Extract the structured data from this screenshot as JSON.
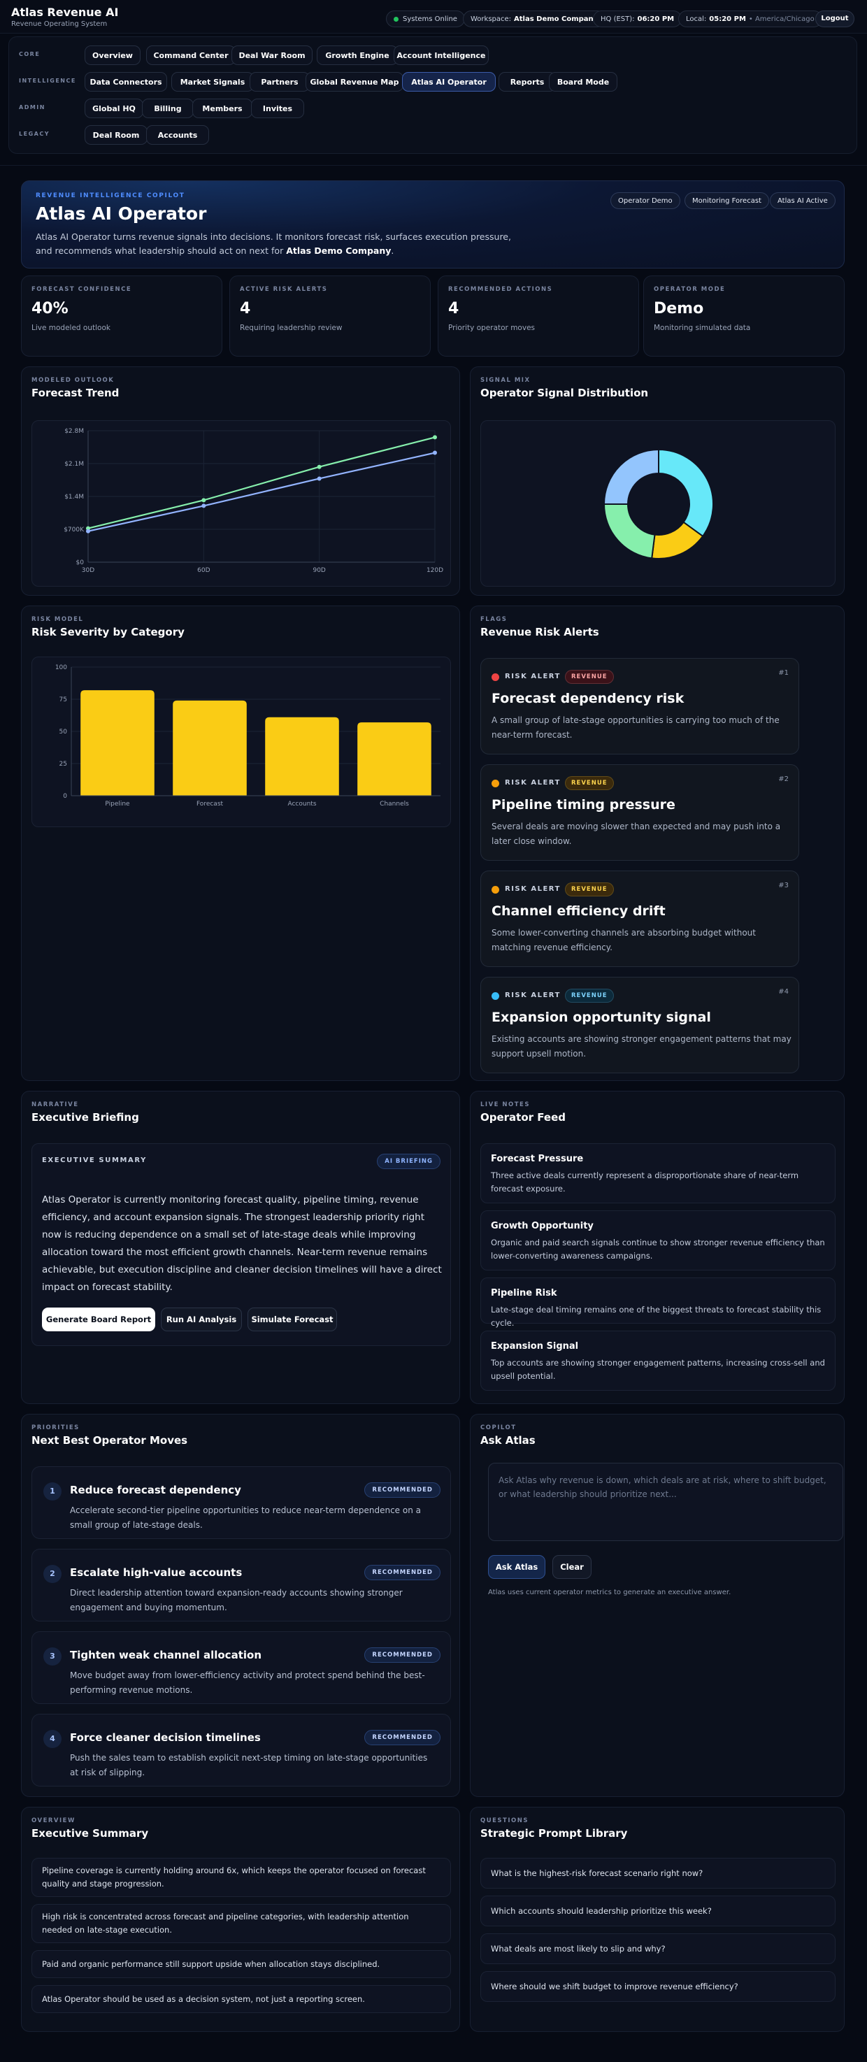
{
  "header": {
    "title": "Atlas Revenue AI",
    "subtitle": "Revenue Operating System",
    "status": "Systems Online",
    "workspace_label": "Workspace:",
    "workspace_value": "Atlas Demo Company",
    "hq_label": "HQ (EST):",
    "hq_time": "06:20 PM",
    "local_label": "Local:",
    "local_time": "05:20 PM",
    "local_tz": "• America/Chicago",
    "logout": "Logout"
  },
  "nav": {
    "groups": [
      {
        "label": "CORE",
        "items": [
          "Overview",
          "Command Center",
          "Deal War Room",
          "Growth Engine",
          "Account Intelligence"
        ]
      },
      {
        "label": "INTELLIGENCE",
        "items": [
          "Data Connectors",
          "Market Signals",
          "Partners",
          "Global Revenue Map",
          "Atlas AI Operator",
          "Reports",
          "Board Mode"
        ]
      },
      {
        "label": "ADMIN",
        "items": [
          "Global HQ",
          "Billing",
          "Members",
          "Invites"
        ]
      },
      {
        "label": "LEGACY",
        "items": [
          "Deal Room",
          "Accounts"
        ]
      }
    ],
    "active": "Atlas AI Operator"
  },
  "hero": {
    "kicker": "REVENUE INTELLIGENCE COPILOT",
    "title": "Atlas AI Operator",
    "desc": "Atlas AI Operator turns revenue signals into decisions. It monitors forecast risk, surfaces execution pressure, and recommends what leadership should act on next for",
    "company": "Atlas Demo Company",
    "tags": [
      "Operator Demo",
      "Monitoring Forecast",
      "Atlas AI Active"
    ]
  },
  "stats": [
    {
      "label": "FORECAST CONFIDENCE",
      "value": "40%",
      "sub": "Live modeled outlook"
    },
    {
      "label": "ACTIVE RISK ALERTS",
      "value": "4",
      "sub": "Requiring leadership review"
    },
    {
      "label": "RECOMMENDED ACTIONS",
      "value": "4",
      "sub": "Priority operator moves"
    },
    {
      "label": "OPERATOR MODE",
      "value": "Demo",
      "sub": "Monitoring simulated data"
    }
  ],
  "forecast": {
    "kicker": "MODELED OUTLOOK",
    "title": "Forecast Trend"
  },
  "signal": {
    "kicker": "SIGNAL MIX",
    "title": "Operator Signal Distribution"
  },
  "risk": {
    "kicker": "RISK MODEL",
    "title": "Risk Severity by Category"
  },
  "chart_data": [
    {
      "type": "line",
      "x": [
        "30D",
        "60D",
        "90D",
        "120D"
      ],
      "y_ticks": [
        "$0",
        "$700K",
        "$1.4M",
        "$2.1M",
        "$2.8M"
      ],
      "ylim": [
        0,
        2800000
      ],
      "series": [
        {
          "color": "#86efac",
          "values": [
            720000,
            1320000,
            2030000,
            2660000
          ]
        },
        {
          "color": "#93b4ff",
          "values": [
            660000,
            1200000,
            1780000,
            2330000
          ]
        }
      ],
      "grid": true
    },
    {
      "type": "pie",
      "donut": true,
      "values": [
        35,
        17,
        23,
        25
      ],
      "colors": [
        "#67e8f9",
        "#facc15",
        "#86efac",
        "#93c5fd"
      ]
    },
    {
      "type": "bar",
      "categories": [
        "Pipeline",
        "Forecast",
        "Accounts",
        "Channels"
      ],
      "values": [
        82,
        74,
        61,
        57
      ],
      "y_ticks": [
        "0",
        "25",
        "50",
        "75",
        "100"
      ],
      "ylim": [
        0,
        100
      ],
      "color": "#facc15",
      "grid": true
    }
  ],
  "alerts": {
    "kicker": "FLAGS",
    "title": "Revenue Risk Alerts",
    "label": "RISK ALERT",
    "items": [
      {
        "badge": "REVENUE",
        "num": "#1",
        "title": "Forecast dependency risk",
        "desc": "A small group of late-stage opportunities is carrying too much of the near-term forecast.",
        "dot": "#ef4444",
        "badge_bg": "#3b1219",
        "badge_fg": "#fca5a5"
      },
      {
        "badge": "REVENUE",
        "num": "#2",
        "title": "Pipeline timing pressure",
        "desc": "Several deals are moving slower than expected and may push into a later close window.",
        "dot": "#f59e0b",
        "badge_bg": "#3b2a0c",
        "badge_fg": "#fcd34d"
      },
      {
        "badge": "REVENUE",
        "num": "#3",
        "title": "Channel efficiency drift",
        "desc": "Some lower-converting channels are absorbing budget without matching revenue efficiency.",
        "dot": "#f59e0b",
        "badge_bg": "#3b2a0c",
        "badge_fg": "#fcd34d"
      },
      {
        "badge": "REVENUE",
        "num": "#4",
        "title": "Expansion opportunity signal",
        "desc": "Existing accounts are showing stronger engagement patterns that may support upsell motion.",
        "dot": "#38bdf8",
        "badge_bg": "#0c2a3b",
        "badge_fg": "#7dd3fc"
      }
    ]
  },
  "briefing": {
    "kicker": "NARRATIVE",
    "title": "Executive Briefing",
    "summary_label": "EXECUTIVE SUMMARY",
    "badge": "AI BRIEFING",
    "text": "Atlas Operator is currently monitoring forecast quality, pipeline timing, revenue efficiency, and account expansion signals. The strongest leadership priority right now is reducing dependence on a small set of late-stage deals while improving allocation toward the most efficient growth channels. Near-term revenue remains achievable, but execution discipline and cleaner decision timelines will have a direct impact on forecast stability.",
    "buttons": [
      "Generate Board Report",
      "Run AI Analysis",
      "Simulate Forecast"
    ]
  },
  "feed": {
    "kicker": "LIVE NOTES",
    "title": "Operator Feed",
    "items": [
      {
        "title": "Forecast Pressure",
        "desc": "Three active deals currently represent a disproportionate share of near-term forecast exposure."
      },
      {
        "title": "Growth Opportunity",
        "desc": "Organic and paid search signals continue to show stronger revenue efficiency than lower-converting awareness campaigns."
      },
      {
        "title": "Pipeline Risk",
        "desc": "Late-stage deal timing remains one of the biggest threats to forecast stability this cycle."
      },
      {
        "title": "Expansion Signal",
        "desc": "Top accounts are showing stronger engagement patterns, increasing cross-sell and upsell potential."
      }
    ]
  },
  "moves": {
    "kicker": "PRIORITIES",
    "title": "Next Best Operator Moves",
    "badge": "RECOMMENDED",
    "items": [
      {
        "num": "1",
        "title": "Reduce forecast dependency",
        "desc": "Accelerate second-tier pipeline opportunities to reduce near-term dependence on a small group of late-stage deals."
      },
      {
        "num": "2",
        "title": "Escalate high-value accounts",
        "desc": "Direct leadership attention toward expansion-ready accounts showing stronger engagement and buying momentum."
      },
      {
        "num": "3",
        "title": "Tighten weak channel allocation",
        "desc": "Move budget away from lower-efficiency activity and protect spend behind the best-performing revenue motions."
      },
      {
        "num": "4",
        "title": "Force cleaner decision timelines",
        "desc": "Push the sales team to establish explicit next-step timing on late-stage opportunities at risk of slipping."
      }
    ]
  },
  "ask": {
    "kicker": "COPILOT",
    "title": "Ask Atlas",
    "placeholder": "Ask Atlas why revenue is down, which deals are at risk, where to shift budget, or what leadership should prioritize next...",
    "ask_btn": "Ask Atlas",
    "clear_btn": "Clear",
    "note": "Atlas uses current operator metrics to generate an executive answer."
  },
  "overview": {
    "kicker": "OVERVIEW",
    "title": "Executive Summary",
    "items": [
      "Pipeline coverage is currently holding around 6x, which keeps the operator focused on forecast quality and stage progression.",
      "High risk is concentrated across forecast and pipeline categories, with leadership attention needed on late-stage execution.",
      "Paid and organic performance still support upside when allocation stays disciplined.",
      "Atlas Operator should be used as a decision system, not just a reporting screen."
    ]
  },
  "prompts": {
    "kicker": "QUESTIONS",
    "title": "Strategic Prompt Library",
    "items": [
      "What is the highest-risk forecast scenario right now?",
      "Which accounts should leadership prioritize this week?",
      "What deals are most likely to slip and why?",
      "Where should we shift budget to improve revenue efficiency?"
    ]
  }
}
